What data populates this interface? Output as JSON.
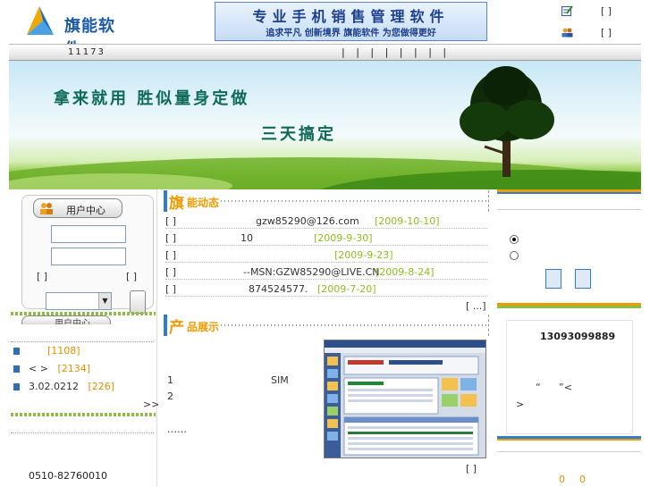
{
  "header": {
    "logo_text": "旗能软件",
    "banner_title": "专业手机销售管理软件",
    "banner_subtitle": "追求平凡 创新境界 旗能软件 为您做得更好",
    "link1": "[ ]",
    "link2": "[ ]"
  },
  "nav": {
    "number": "11173",
    "links": "| | | | | | | |"
  },
  "hero": {
    "line1": "拿来就用  胜似量身定做",
    "line2": "三天搞定"
  },
  "user_center": {
    "tab_label": "用户中心",
    "left_bracket": "[ ]",
    "right_bracket": "[ ]",
    "tab2_label": "用户中心"
  },
  "downloads": [
    {
      "label": "",
      "count": "[1108]"
    },
    {
      "label": "<    >",
      "count": "[2134]"
    },
    {
      "label": "3.02.0212",
      "count": "[226]"
    }
  ],
  "downloads_more": ">>",
  "contact_phone": "0510-82760010",
  "dynamics": {
    "big": "旗",
    "small": "能动态",
    "items": [
      {
        "tag": "[ ]",
        "text": "gzw85290@126.com",
        "date": "[2009-10-10]"
      },
      {
        "tag": "[ ]",
        "text": "10",
        "date": "[2009-9-30]"
      },
      {
        "tag": "[ ]",
        "text": "",
        "date": "[2009-9-23]"
      },
      {
        "tag": "[ ]",
        "text": "--MSN:GZW85290@LIVE.CN",
        "date": "[2009-8-24]"
      },
      {
        "tag": "[ ]",
        "text": "874524577.",
        "date": "[2009-7-20]"
      }
    ],
    "more": "[ ...]"
  },
  "products": {
    "big": "产",
    "small": "品展示",
    "line1a": "1",
    "line1b": "SIM",
    "line2": "2",
    "ellipsis": "……",
    "more": "[ ]"
  },
  "right": {
    "qq": "13093099889",
    "q1": "“",
    "q2": "”<",
    "q3": ">",
    "n1": "0",
    "n2": "0"
  },
  "colors": {
    "accent_blue": "#2f7dd1",
    "accent_orange": "#f09b00",
    "accent_green": "#8cbf3f",
    "date_green": "#8cbf1f"
  }
}
